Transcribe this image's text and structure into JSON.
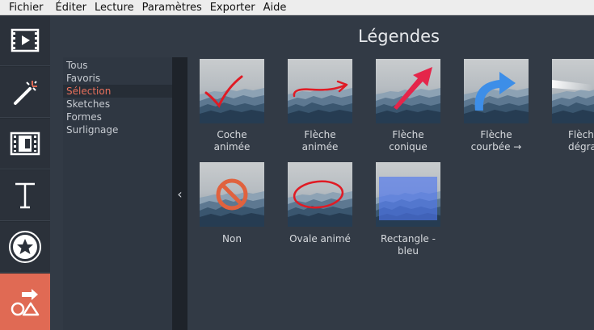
{
  "menu": [
    "Fichier",
    "Éditer",
    "Lecture",
    "Paramètres",
    "Exporter",
    "Aide"
  ],
  "toolbar": [
    {
      "icon": "video-import-icon"
    },
    {
      "icon": "magic-wand-icon"
    },
    {
      "icon": "transitions-icon"
    },
    {
      "icon": "text-icon"
    },
    {
      "icon": "sticker-icon"
    },
    {
      "icon": "callouts-icon",
      "active": true
    }
  ],
  "page_title": "Légendes",
  "categories": [
    {
      "label": "Tous"
    },
    {
      "label": "Favoris"
    },
    {
      "label": "Sélection",
      "selected": true
    },
    {
      "label": "Sketches"
    },
    {
      "label": "Formes"
    },
    {
      "label": "Surlignage"
    }
  ],
  "collapse_glyph": "‹",
  "items": [
    {
      "label": "Coche animée",
      "line1": "Coche",
      "line2": "animée",
      "overlay": "checkmark"
    },
    {
      "label": "Flèche animée",
      "line1": "Flèche",
      "line2": "animée",
      "overlay": "arrow-swoosh"
    },
    {
      "label": "Flèche conique",
      "line1": "Flèche",
      "line2": "conique",
      "overlay": "arrow-tapered"
    },
    {
      "label": "Flèche courbée →",
      "line1": "Flèche",
      "line2": "courbée →",
      "overlay": "arrow-curved"
    },
    {
      "label": "Flèche dégradée",
      "line1": "Flèch",
      "line2": "dégrad",
      "overlay": "arrow-gradient"
    },
    {
      "label": "Non",
      "line1": "Non",
      "line2": "",
      "overlay": "no-sign"
    },
    {
      "label": "Ovale animé",
      "line1": "Ovale animé",
      "line2": "",
      "overlay": "oval"
    },
    {
      "label": "Rectangle - bleu",
      "line1": "Rectangle -",
      "line2": "bleu",
      "overlay": "blue-rectangle"
    }
  ],
  "colors": {
    "accent": "#e06a54",
    "arrow_red": "#e5254a",
    "arrow_blue": "#3d8ee8",
    "sketch_red": "#e01b24"
  }
}
